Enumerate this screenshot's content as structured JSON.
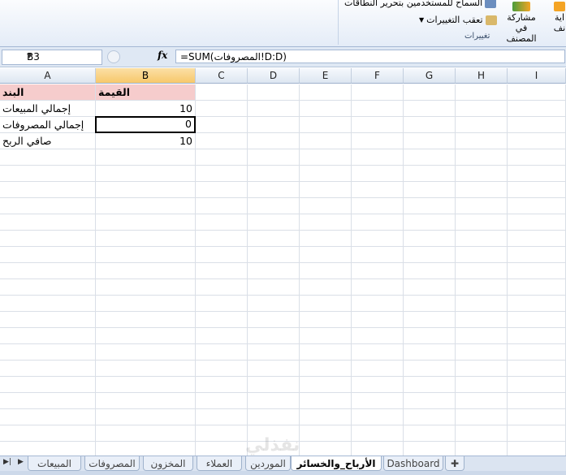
{
  "ribbon": {
    "allow_users_label": "السماح للمستخدمين بتحرير النطاقات",
    "track_changes_label": "تعقب التغييرات",
    "group_label": "تغييرات",
    "share_label_line1": "مشاركة في",
    "share_label_line2": "المصنف",
    "cut_label_line1": "اية",
    "cut_label_line2": "نف",
    "accent_color": "#f4a424"
  },
  "formula_bar": {
    "name_box": "B3",
    "fx": "fx",
    "formula": "=SUM(المصروفات!D:D)"
  },
  "grid": {
    "columns": [
      "A",
      "B",
      "C",
      "D",
      "E",
      "F",
      "G",
      "H",
      "I"
    ],
    "selected_column": "B",
    "rows": [
      {
        "a": "البند",
        "b": "القيمة"
      },
      {
        "a": "إجمالي المبيعات",
        "b": "10"
      },
      {
        "a": "إجمالي المصروفات",
        "b": "0"
      },
      {
        "a": "صافي الربح",
        "b": "10"
      }
    ],
    "header_color": "#f6cccc"
  },
  "sheet_tabs": {
    "tabs": [
      "المبيعات",
      "المصروفات",
      "المخزون",
      "العملاء",
      "الموردين",
      "الأرباح_والخسائر",
      "Dashboard"
    ],
    "active": "الأرباح_والخسائر"
  },
  "watermark": "نفذلي"
}
